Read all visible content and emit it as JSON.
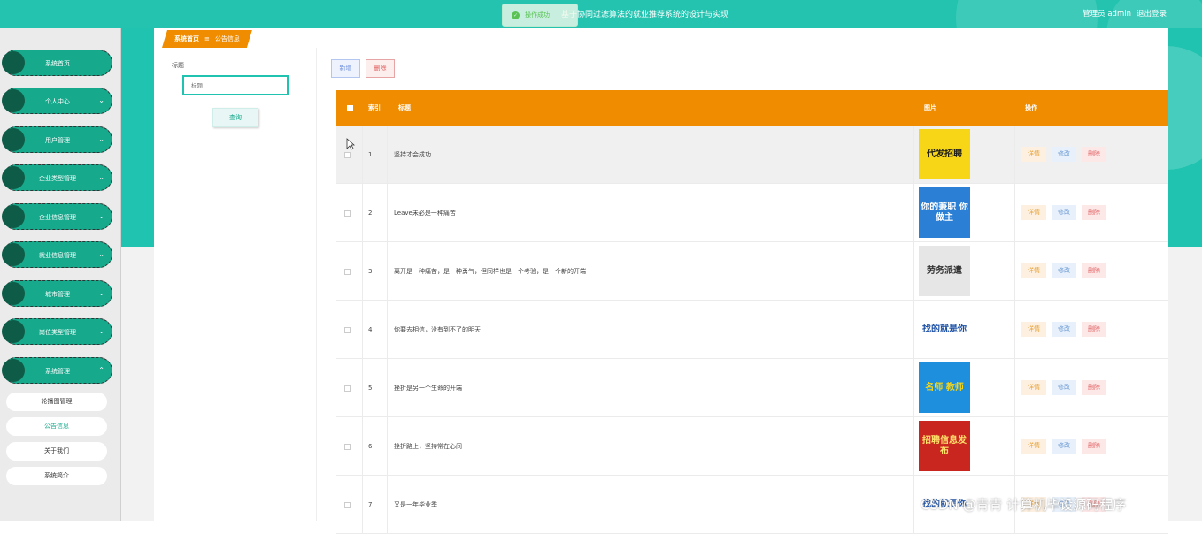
{
  "header": {
    "title": "基于协同过滤算法的就业推荐系统的设计与实现",
    "admin_label": "管理员 admin",
    "logout_label": "退出登录"
  },
  "toast": {
    "text": "操作成功"
  },
  "sidebar": {
    "items": [
      {
        "label": "系统首页",
        "arrow": ""
      },
      {
        "label": "个人中心",
        "arrow": "⌄"
      },
      {
        "label": "用户管理",
        "arrow": "⌄"
      },
      {
        "label": "企业类型管理",
        "arrow": "⌄"
      },
      {
        "label": "企业信息管理",
        "arrow": "⌄"
      },
      {
        "label": "就业信息管理",
        "arrow": "⌄"
      },
      {
        "label": "城市管理",
        "arrow": "⌄"
      },
      {
        "label": "岗位类型管理",
        "arrow": "⌄"
      },
      {
        "label": "系统管理",
        "arrow": "⌃"
      }
    ],
    "subitems": [
      {
        "label": "轮播图管理"
      },
      {
        "label": "公告信息"
      },
      {
        "label": "关于我们"
      },
      {
        "label": "系统简介"
      }
    ]
  },
  "breadcrumb": {
    "home": "系统首页",
    "sep": "≡",
    "current": "公告信息"
  },
  "filter": {
    "label": "标题",
    "placeholder": "标题",
    "search_button": "查询"
  },
  "toolbar": {
    "add_label": "新增",
    "delete_label": "删除"
  },
  "table": {
    "headers": {
      "index": "索引",
      "title": "标题",
      "image": "图片",
      "action": "操作"
    },
    "rows": [
      {
        "index": "1",
        "title": "坚持才会成功",
        "image_text": "代发招聘"
      },
      {
        "index": "2",
        "title": "Leave未必是一种痛苦",
        "image_text": "你的兼职 你做主"
      },
      {
        "index": "3",
        "title": "离开是一种痛苦，是一种勇气，但同样也是一个考验，是一个新的开端",
        "image_text": "劳务派遣"
      },
      {
        "index": "4",
        "title": "你要去相信，没有到不了的明天",
        "image_text": "找的就是你"
      },
      {
        "index": "5",
        "title": "挫折是另一个生命的开端",
        "image_text": "名师 教师"
      },
      {
        "index": "6",
        "title": "挫折路上，坚持常在心间",
        "image_text": "招聘信息发布"
      },
      {
        "index": "7",
        "title": "又是一年毕业季",
        "image_text": "找的就是你"
      }
    ],
    "actions": {
      "detail": "详情",
      "edit": "修改",
      "delete": "删除"
    }
  },
  "watermark": "CSDN @青青  计算机毕设源码程序",
  "colors": {
    "teal": "#23c3b0",
    "orange": "#f08c00",
    "sidebar_green": "#17a98c"
  }
}
